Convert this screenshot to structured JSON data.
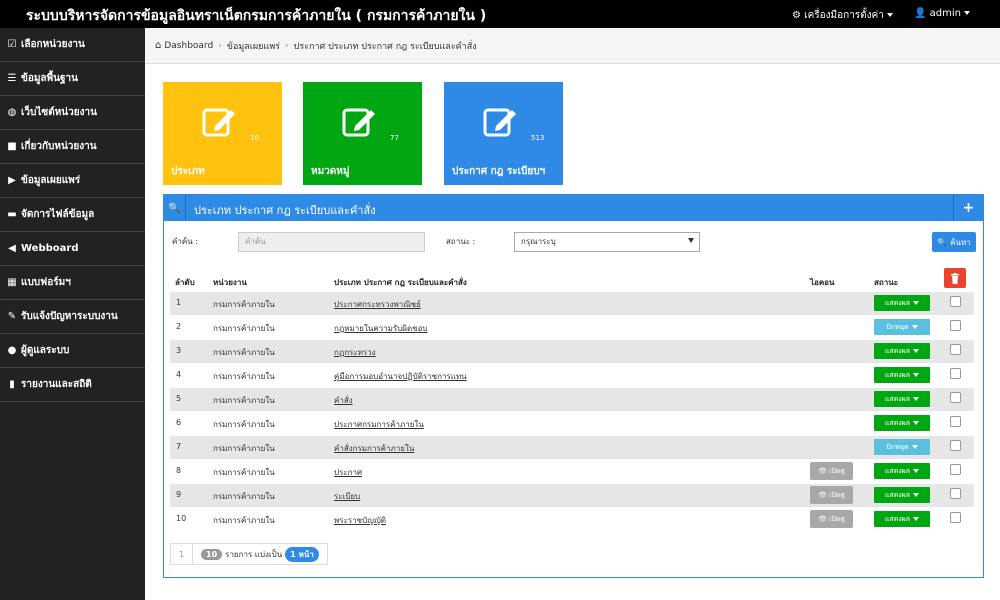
{
  "header": {
    "title": "ระบบบริหารจัดการข้อมูลอินทราเน็ตกรมการค้าภายใน ( กรมการค้าภายใน )",
    "tools_label": "เครื่องมือการตั้งค่า",
    "user_label": "admin"
  },
  "sidebar": {
    "items": [
      {
        "label": "เลือกหน่วยงาน",
        "icon": "check-square-icon"
      },
      {
        "label": "ข้อมูลพื้นฐาน",
        "icon": "list-icon"
      },
      {
        "label": "เว็บไซต์หน่วยงาน",
        "icon": "globe-icon"
      },
      {
        "label": "เกี่ยวกับหน่วยงาน",
        "icon": "book-icon"
      },
      {
        "label": "ข้อมูลเผยแพร่",
        "icon": "video-icon"
      },
      {
        "label": "จัดการไฟล์ข้อมูล",
        "icon": "folder-icon"
      },
      {
        "label": "Webboard",
        "icon": "bullhorn-icon"
      },
      {
        "label": "แบบฟอร์มฯ",
        "icon": "table-icon"
      },
      {
        "label": "รับแจ้งปัญหาระบบงาน",
        "icon": "wrench-icon"
      },
      {
        "label": "ผู้ดูแลระบบ",
        "icon": "user-icon"
      },
      {
        "label": "รายงานและสถิติ",
        "icon": "bar-chart-icon"
      }
    ]
  },
  "breadcrumb": {
    "home": "Dashboard",
    "parent": "ข้อมูลเผยแพร่",
    "current": "ประกาศ ประเภท ประกาศ กฎ ระเบียบและคำสั่ง"
  },
  "tiles": [
    {
      "label": "ประเภท",
      "count": "10",
      "color": "#ffc20e"
    },
    {
      "label": "หมวดหมู่",
      "count": "77",
      "color": "#00a712"
    },
    {
      "label": "ประกาศ กฎ ระเบียบฯ",
      "count": "513",
      "color": "#2f8ae6"
    }
  ],
  "panel": {
    "title": "ประเภท ประกาศ กฎ ระเบียบและคำสั่ง",
    "keyword_label": "คำค้น :",
    "keyword_placeholder": "คำค้น",
    "status_label": "สถานะ :",
    "status_value": "กรุณาระบุ",
    "search_label": "ค้นหา"
  },
  "table": {
    "headers": {
      "no": "ลำดับ",
      "unit": "หน่วยงาน",
      "type": "ประเภท ประกาศ กฎ ระเบียบและคำสั่ง",
      "icon": "ไอคอน",
      "status": "สถานะ"
    },
    "rows": [
      {
        "no": "1",
        "unit": "กรมการค้าภายใน",
        "type": "ประกาศกระทรวงพาณิชย์",
        "icon": "",
        "status": "แสดงผล",
        "status_kind": "show"
      },
      {
        "no": "2",
        "unit": "กรมการค้าภายใน",
        "type": "กฎหมายในความรับผิดชอบ",
        "icon": "",
        "status": "ปักหมุด",
        "status_kind": "pin"
      },
      {
        "no": "3",
        "unit": "กรมการค้าภายใน",
        "type": "กฎกระทรวง",
        "icon": "",
        "status": "แสดงผล",
        "status_kind": "show"
      },
      {
        "no": "4",
        "unit": "กรมการค้าภายใน",
        "type": "คู่มือการมอบอำนาจปฏิบัติราชการแทน",
        "icon": "",
        "status": "แสดงผล",
        "status_kind": "show"
      },
      {
        "no": "5",
        "unit": "กรมการค้าภายใน",
        "type": "คำสั่ง",
        "icon": "",
        "status": "แสดงผล",
        "status_kind": "show"
      },
      {
        "no": "6",
        "unit": "กรมการค้าภายใน",
        "type": "ประกาศกรมการค้าภายใน",
        "icon": "",
        "status": "แสดงผล",
        "status_kind": "show"
      },
      {
        "no": "7",
        "unit": "กรมการค้าภายใน",
        "type": "คำสั่งกรมการค้าภายใน",
        "icon": "",
        "status": "ปักหมุด",
        "status_kind": "pin"
      },
      {
        "no": "8",
        "unit": "กรมการค้าภายใน",
        "type": "ประกาศ",
        "icon": "เปิดดู",
        "status": "แสดงผล",
        "status_kind": "show"
      },
      {
        "no": "9",
        "unit": "กรมการค้าภายใน",
        "type": "ระเบียบ",
        "icon": "เปิดดู",
        "status": "แสดงผล",
        "status_kind": "show"
      },
      {
        "no": "10",
        "unit": "กรมการค้าภายใน",
        "type": "พระราชบัญญัติ",
        "icon": "เปิดดู",
        "status": "แสดงผล",
        "status_kind": "show"
      }
    ]
  },
  "pagination": {
    "current_page": "1",
    "total": "10",
    "text": "รายการ แบ่งเป็น",
    "pages": "1 หน้า"
  },
  "colors": {
    "show": "#00a712",
    "pin": "#5bc0de",
    "accent": "#2f8ae6",
    "danger": "#e8452c"
  }
}
